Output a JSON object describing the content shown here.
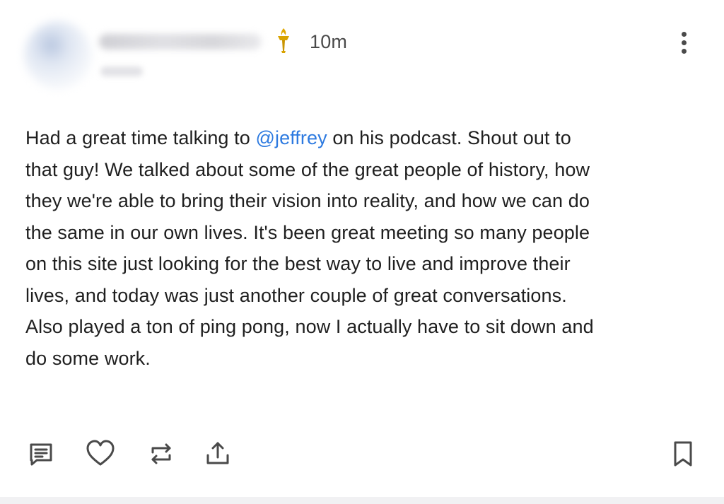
{
  "post": {
    "timestamp": "10m",
    "body_lines": [
      {
        "before": "Had a great time talking to ",
        "mention": "@jeffrey",
        "after": " on his podcast. Shout out to"
      },
      "that guy! We talked about some of the great people of history, how",
      "they we're able to bring their vision into reality, and how we can do",
      "the same in our own lives. It's been great meeting so many people",
      "on this site just looking for the best way to live and improve their",
      "lives, and today was just another couple of great conversations.",
      "Also played a ton of ping pong, now I actually have to sit down and",
      "do some work."
    ]
  },
  "icons": {
    "badge": "torch-icon",
    "more": "more-vertical-icon",
    "actions": [
      "comment-icon",
      "heart-icon",
      "repost-icon",
      "share-icon",
      "bookmark-icon"
    ]
  },
  "colors": {
    "mention": "#2d7ae0",
    "badge_gold": "#d9a300",
    "icon_gray": "#4a4a4a"
  }
}
